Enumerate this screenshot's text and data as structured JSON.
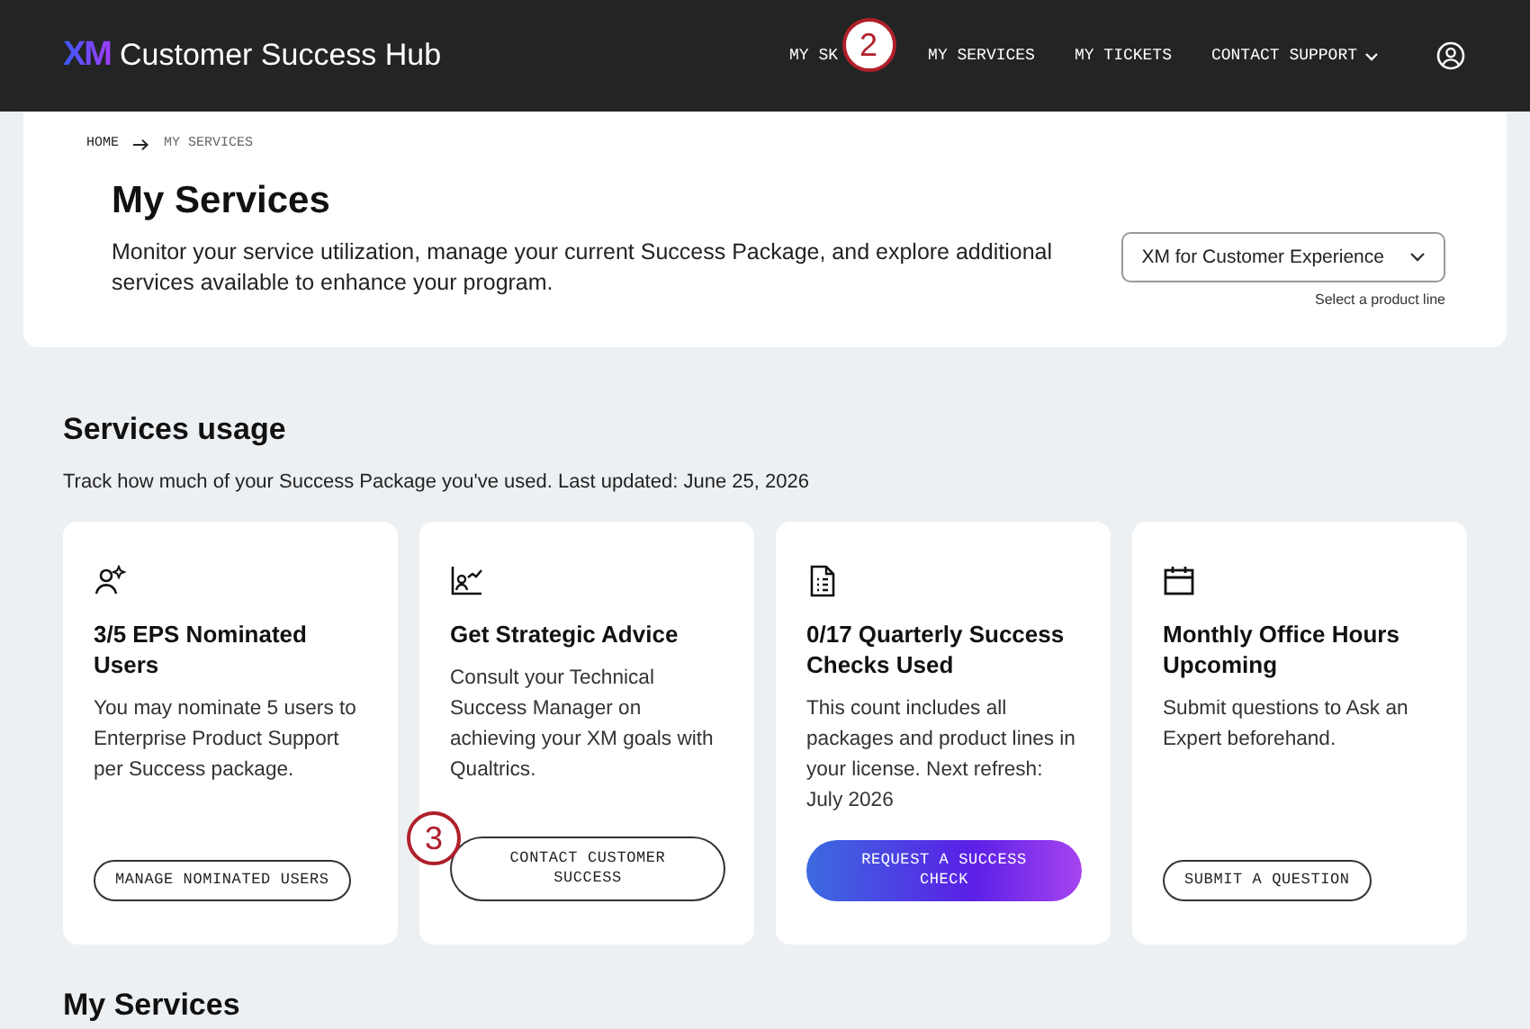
{
  "header": {
    "logo": "XM",
    "title": "Customer Success Hub",
    "nav": [
      {
        "label": "MY SK",
        "callout": "2"
      },
      {
        "label": "MY SERVICES"
      },
      {
        "label": "MY TICKETS"
      },
      {
        "label": "CONTACT SUPPORT",
        "dropdown": true
      }
    ]
  },
  "breadcrumb": [
    "HOME",
    "MY SERVICES"
  ],
  "page": {
    "title": "My Services",
    "description": "Monitor your service utilization, manage your current Success Package, and explore additional services available to enhance your program.",
    "product_select": {
      "value": "XM for Customer Experience",
      "hint": "Select a product line"
    }
  },
  "usage": {
    "title": "Services usage",
    "subtitle": "Track how much of your Success Package you've used. Last updated: June 25, 2026",
    "cards": [
      {
        "title": "3/5 EPS Nominated Users",
        "text": "You may nominate 5 users to Enterprise Product Support per Success package.",
        "button": {
          "label": "MANAGE NOMINATED USERS",
          "kind": "outline"
        }
      },
      {
        "title": "Get Strategic Advice",
        "text": "Consult your Technical Success Manager on achieving your XM goals with Qualtrics.",
        "button": {
          "label": "CONTACT CUSTOMER SUCCESS",
          "kind": "outline",
          "callout": "3"
        }
      },
      {
        "title": "0/17 Quarterly Success Checks Used",
        "text": "This count includes all packages and product lines in your license. Next refresh: July 2026",
        "button": {
          "label": "REQUEST A SUCCESS CHECK",
          "kind": "primary"
        }
      },
      {
        "title": "Monthly Office Hours Upcoming",
        "text": "Submit questions to Ask an Expert beforehand.",
        "button": {
          "label": "SUBMIT A QUESTION",
          "kind": "outline"
        }
      }
    ]
  },
  "next_section": {
    "title": "My Services"
  }
}
